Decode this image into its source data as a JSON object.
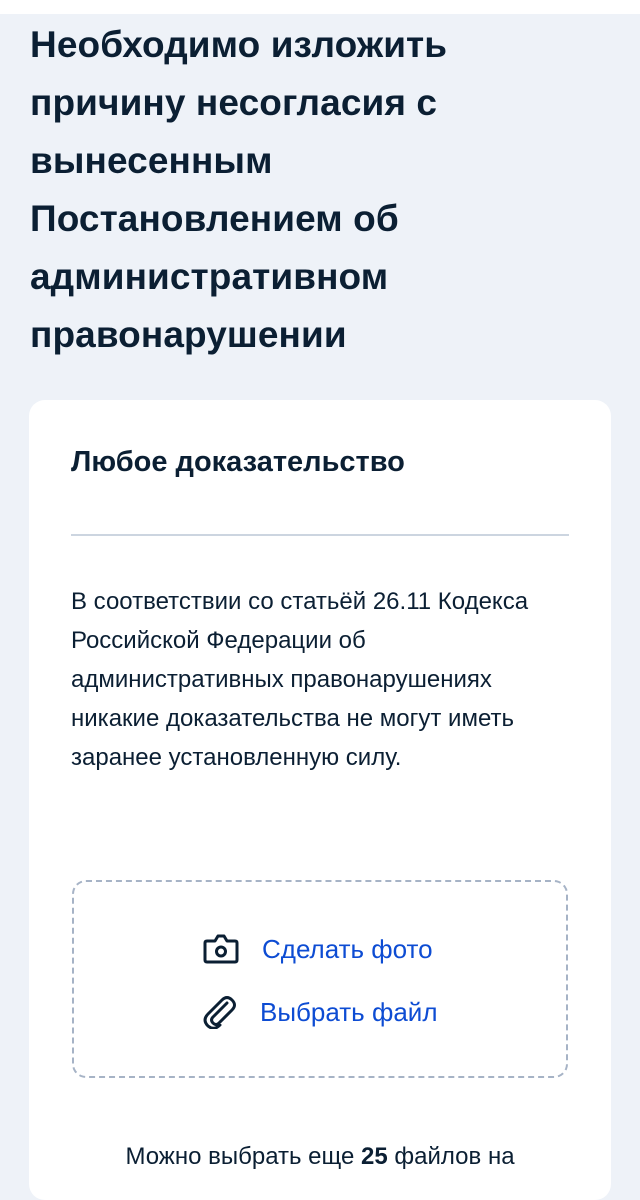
{
  "page": {
    "title": "Необходимо изложить причину несогласия с вынесенным Постановлением об административном правонарушении"
  },
  "evidence_card": {
    "title": "Любое доказательство",
    "description": "В соответствии со статьёй 26.11 Кодекса Российской Федерации об административных правонарушениях никакие доказательства не могут иметь заранее установленную силу.",
    "upload": {
      "take_photo_label": "Сделать фото",
      "take_photo_icon": "camera-icon",
      "choose_file_label": "Выбрать файл",
      "choose_file_icon": "paperclip-icon"
    },
    "limit_note": {
      "prefix": "Можно выбрать еще ",
      "count": "25",
      "suffix": " файлов на"
    }
  },
  "colors": {
    "background": "#eef2f8",
    "card": "#ffffff",
    "text": "#0b1f33",
    "accent_link": "#0d4cd3",
    "divider": "#ccd5e0",
    "dashed_border": "#a6b3c6"
  }
}
